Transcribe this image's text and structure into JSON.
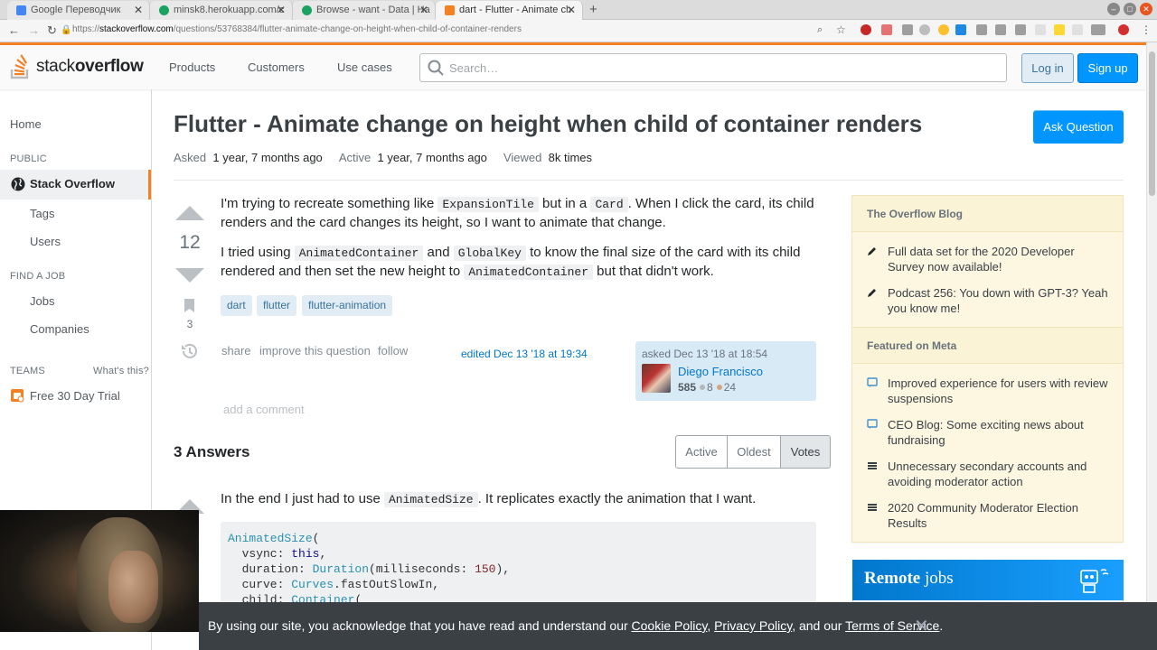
{
  "browser": {
    "tabs": [
      {
        "title": "Google Переводчик",
        "color": "#4285f4"
      },
      {
        "title": "minsk8.herokuapp.com/c",
        "color": "#1aa260"
      },
      {
        "title": "Browse - want - Data | Ha",
        "color": "#1aa260"
      },
      {
        "title": "dart - Flutter - Animate ch",
        "color": "#f48024"
      }
    ],
    "url_scheme": "https://",
    "url_host": "stackoverflow.com",
    "url_path": "/questions/53768384/flutter-animate-change-on-height-when-child-of-container-renders"
  },
  "topbar": {
    "logo_light": "stack",
    "logo_bold": "overflow",
    "nav": [
      "Products",
      "Customers",
      "Use cases"
    ],
    "search_placeholder": "Search…",
    "login": "Log in",
    "signup": "Sign up"
  },
  "sidebar": {
    "home": "Home",
    "public_head": "PUBLIC",
    "stack_overflow": "Stack Overflow",
    "tags": "Tags",
    "users": "Users",
    "jobs_head": "FIND A JOB",
    "jobs": "Jobs",
    "companies": "Companies",
    "teams_head": "TEAMS",
    "whats_this": "What's this?",
    "free_trial": "Free 30 Day Trial"
  },
  "question": {
    "title": "Flutter - Animate change on height when child of container renders",
    "asked_label": "Asked",
    "asked_value": "1 year, 7 months ago",
    "active_label": "Active",
    "active_value": "1 year, 7 months ago",
    "viewed_label": "Viewed",
    "viewed_value": "8k times",
    "ask_button": "Ask Question",
    "votes": "12",
    "bookmarks": "3",
    "p1": {
      "a": "I'm trying to recreate something like ",
      "c1": "ExpansionTile",
      "b": " but in a ",
      "c2": "Card",
      "d": ". When I click the card, its child renders and the card changes its height, so I want to animate that change."
    },
    "p2": {
      "a": "I tried using ",
      "c1": "AnimatedContainer",
      "b": " and ",
      "c2": "GlobalKey",
      "d": " to know the final size of the card with its child rendered and then set the new height to ",
      "c3": "AnimatedContainer",
      "e": " but that didn't work."
    },
    "tags": [
      "dart",
      "flutter",
      "flutter-animation"
    ],
    "menu": [
      "share",
      "improve this question",
      "follow"
    ],
    "edited": "edited Dec 13 '18 at 19:34",
    "owner": {
      "asked": "asked Dec 13 '18 at 18:54",
      "name": "Diego Francisco",
      "rep": "585",
      "silver": "8",
      "bronze": "24"
    },
    "add_comment": "add a comment"
  },
  "answers": {
    "heading": "3 Answers",
    "sort": [
      "Active",
      "Oldest",
      "Votes"
    ],
    "active_sort": "Votes",
    "first": {
      "text_a": "In the end I just had to use ",
      "code": "AnimatedSize",
      "text_b": ". It replicates exactly the animation that I want.",
      "code_lines": [
        [
          "AnimatedSize",
          "("
        ],
        [
          "  vsync: ",
          "this",
          ","
        ],
        [
          "  duration: ",
          "Duration",
          "(milliseconds: ",
          "150",
          "),"
        ],
        [
          "  curve: ",
          "Curves",
          ".fastOutSlowIn,"
        ],
        [
          "  child: ",
          "Container",
          "("
        ]
      ]
    }
  },
  "blog": {
    "head1": "The Overflow Blog",
    "items1": [
      "Full data set for the 2020 Developer Survey now available!",
      "Podcast 256: You down with GPT-3? Yeah you know me!"
    ],
    "head2": "Featured on Meta",
    "items2": [
      "Improved experience for users with review suspensions",
      "CEO Blog: Some exciting news about fundraising",
      "Unnecessary secondary accounts and avoiding moderator action",
      "2020 Community Moderator Election Results"
    ]
  },
  "remote_jobs": {
    "bold": "Remote",
    "rest": " jobs"
  },
  "cookie": {
    "text": "By using our site, you acknowledge that you have read and understand our ",
    "cookie_policy": "Cookie Policy",
    "sep1": ", ",
    "privacy_policy": "Privacy Policy",
    "sep2": ", and our ",
    "terms": "Terms of Service",
    "end": "."
  },
  "colors": {
    "accent": "#f48024",
    "link": "#0077cc",
    "primary_button": "#0095ff"
  }
}
